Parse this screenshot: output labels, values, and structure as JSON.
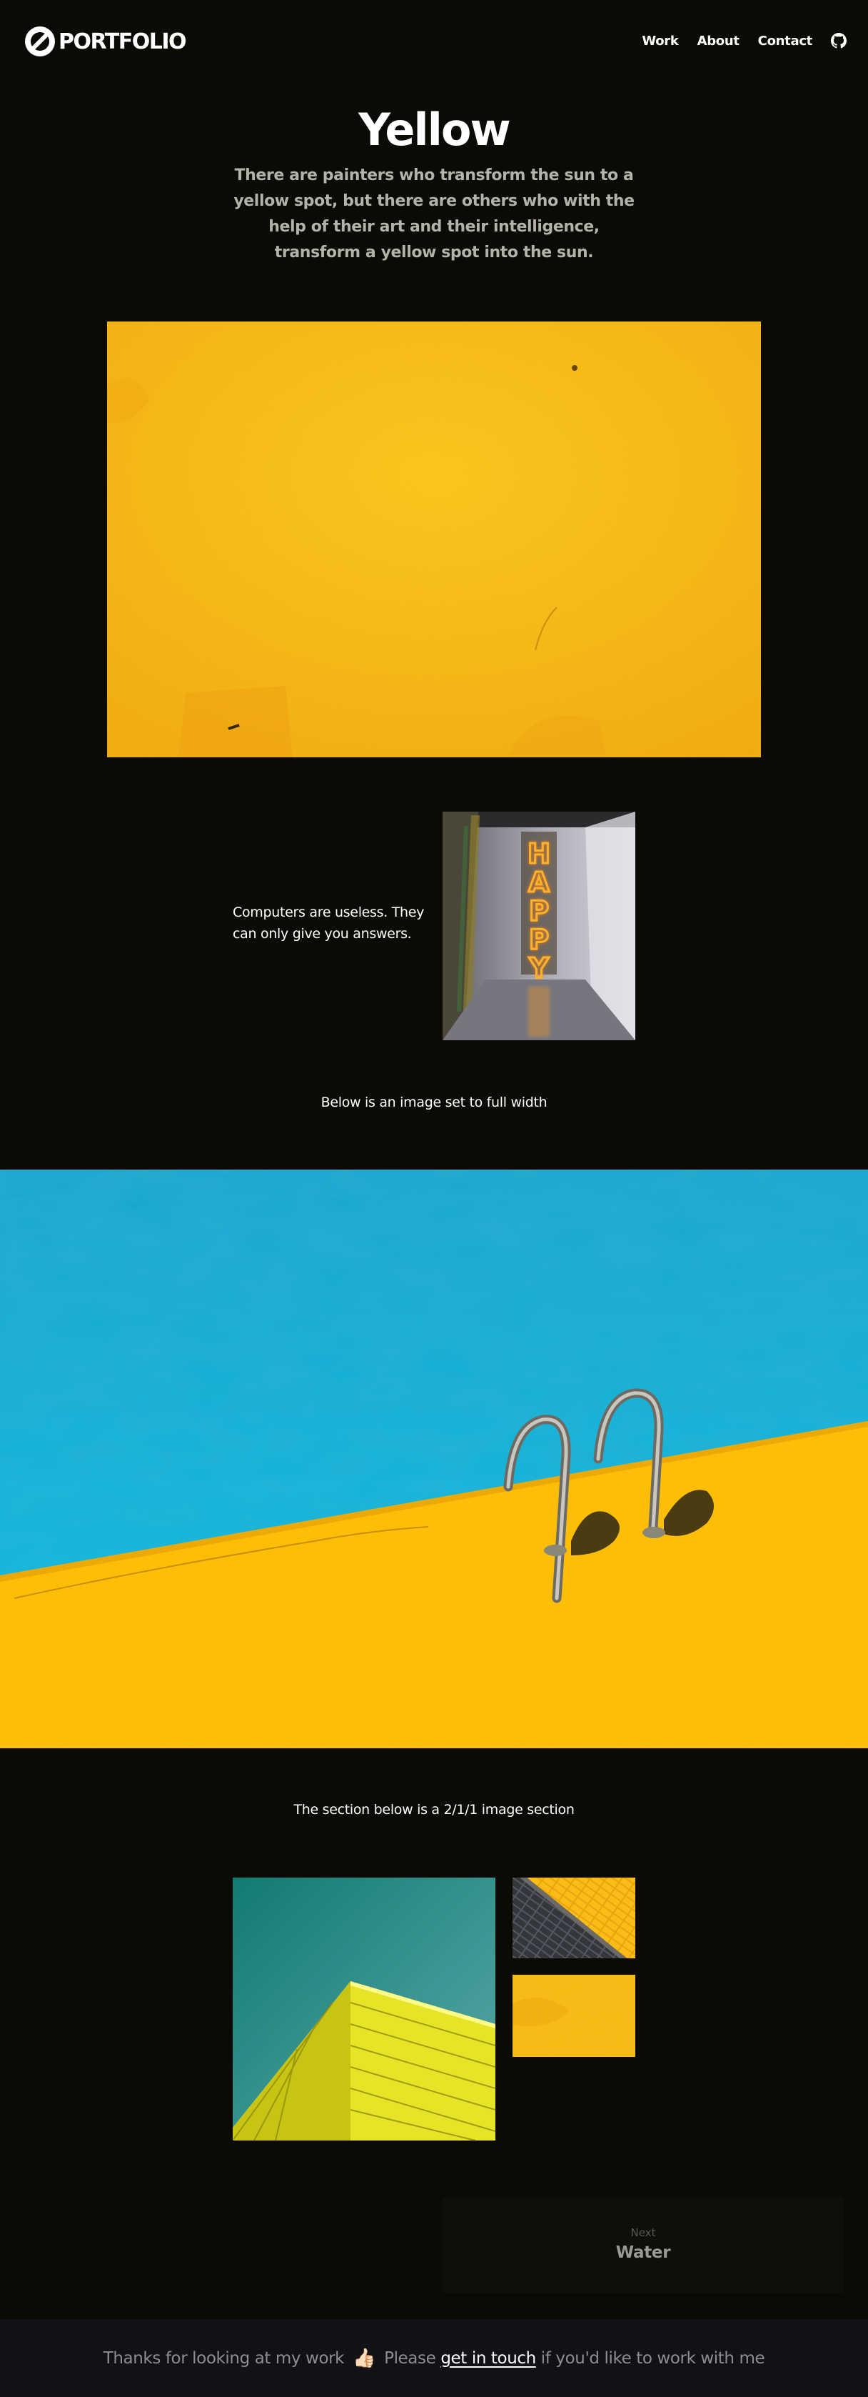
{
  "header": {
    "brand": "PORTFOLIO",
    "nav": [
      {
        "label": "Work"
      },
      {
        "label": "About"
      },
      {
        "label": "Contact"
      }
    ]
  },
  "intro": {
    "title": "Yellow",
    "lead": "There are painters who transform the sun to a yellow spot, but there are others who with the help of their art and their intelligence, transform a yellow spot into the sun."
  },
  "feature": {
    "quote": "Computers are useless. They can only give you answers.",
    "sign_text": "HAPPY"
  },
  "captions": {
    "full_width": "Below is an image set to full width",
    "grid": "The section below is a 2/1/1 image section"
  },
  "next": {
    "label": "Next",
    "title": "Water"
  },
  "footer": {
    "before": "Thanks for looking at my work",
    "please": "Please",
    "link": "get in touch",
    "after": "if you'd like to work with me",
    "thumb_emoji": "👍🏻"
  },
  "colors": {
    "background": "#0b0a05",
    "yellow": "#fbbf11",
    "pool_blue": "#16b6d6",
    "footer_bg": "#121116"
  }
}
